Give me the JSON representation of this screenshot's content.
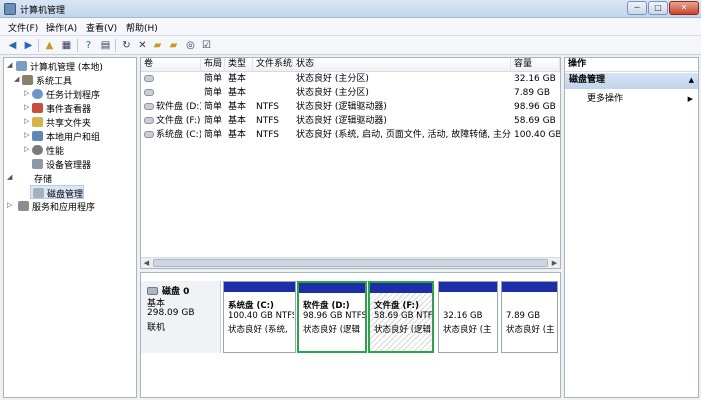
{
  "window": {
    "title": "计算机管理",
    "controls": {
      "min": "─",
      "max": "□",
      "close": "✕"
    }
  },
  "menu": [
    "文件(F)",
    "操作(A)",
    "查看(V)",
    "帮助(H)"
  ],
  "toolbar_icons": [
    "back-icon",
    "forward-icon",
    "up-folder-icon",
    "show-hide-tree-icon",
    "help-icon",
    "properties-icon",
    "connect-icon",
    "delete-icon",
    "open-folder-icon",
    "export-icon",
    "search-icon",
    "refresh-icon"
  ],
  "tree": {
    "root": "计算机管理 (本地)",
    "items": [
      {
        "label": "系统工具",
        "level": 1,
        "expanded": true
      },
      {
        "label": "任务计划程序",
        "level": 2
      },
      {
        "label": "事件查看器",
        "level": 2
      },
      {
        "label": "共享文件夹",
        "level": 2
      },
      {
        "label": "本地用户和组",
        "level": 2
      },
      {
        "label": "性能",
        "level": 2
      },
      {
        "label": "设备管理器",
        "level": 2
      },
      {
        "label": "存储",
        "level": 1,
        "expanded": true
      },
      {
        "label": "磁盘管理",
        "level": 2,
        "selected": true
      },
      {
        "label": "服务和应用程序",
        "level": 1
      }
    ]
  },
  "volume_table": {
    "columns": [
      "卷",
      "布局",
      "类型",
      "文件系统",
      "状态",
      "容量"
    ],
    "rows": [
      {
        "volume": "",
        "layout": "简单",
        "type": "基本",
        "fs": "",
        "status": "状态良好 (主分区)",
        "capacity": "32.16 GB"
      },
      {
        "volume": "",
        "layout": "简单",
        "type": "基本",
        "fs": "",
        "status": "状态良好 (主分区)",
        "capacity": "7.89 GB"
      },
      {
        "volume": "软件盘 (D:)",
        "layout": "简单",
        "type": "基本",
        "fs": "NTFS",
        "status": "状态良好 (逻辑驱动器)",
        "capacity": "98.96 GB"
      },
      {
        "volume": "文件盘 (F:)",
        "layout": "简单",
        "type": "基本",
        "fs": "NTFS",
        "status": "状态良好 (逻辑驱动器)",
        "capacity": "58.69 GB"
      },
      {
        "volume": "系统盘 (C:)",
        "layout": "简单",
        "type": "基本",
        "fs": "NTFS",
        "status": "状态良好 (系统, 启动, 页面文件, 活动, 故障转储, 主分区)",
        "capacity": "100.40 GB"
      }
    ]
  },
  "disk": {
    "name": "磁盘 0",
    "type": "基本",
    "size": "298.09 GB",
    "state": "联机",
    "partitions": [
      {
        "title": "系统盘 (C:)",
        "size": "100.40 GB NTFS",
        "status": "状态良好 (系统,",
        "kind": "primary"
      },
      {
        "title": "软件盘 (D:)",
        "size": "98.96 GB NTFS",
        "status": "状态良好 (逻辑",
        "kind": "logical"
      },
      {
        "title": "文件盘 (F:)",
        "size": "58.69 GB NTF",
        "status": "状态良好 (逻辑",
        "kind": "logical-selected"
      },
      {
        "title": "",
        "size": "32.16 GB",
        "status": "状态良好 (主",
        "kind": "primary"
      },
      {
        "title": "",
        "size": "7.89 GB",
        "status": "状态良好 (主",
        "kind": "primary"
      }
    ]
  },
  "actions": {
    "header": "操作",
    "section": "磁盘管理",
    "more": "更多操作",
    "collapse_glyph": "▲",
    "expand_glyph": "▶"
  },
  "colors": {
    "primary_bar": "#1c2fa8",
    "logical_bar": "#1c2fa8",
    "logical_border": "#2ea44a"
  }
}
